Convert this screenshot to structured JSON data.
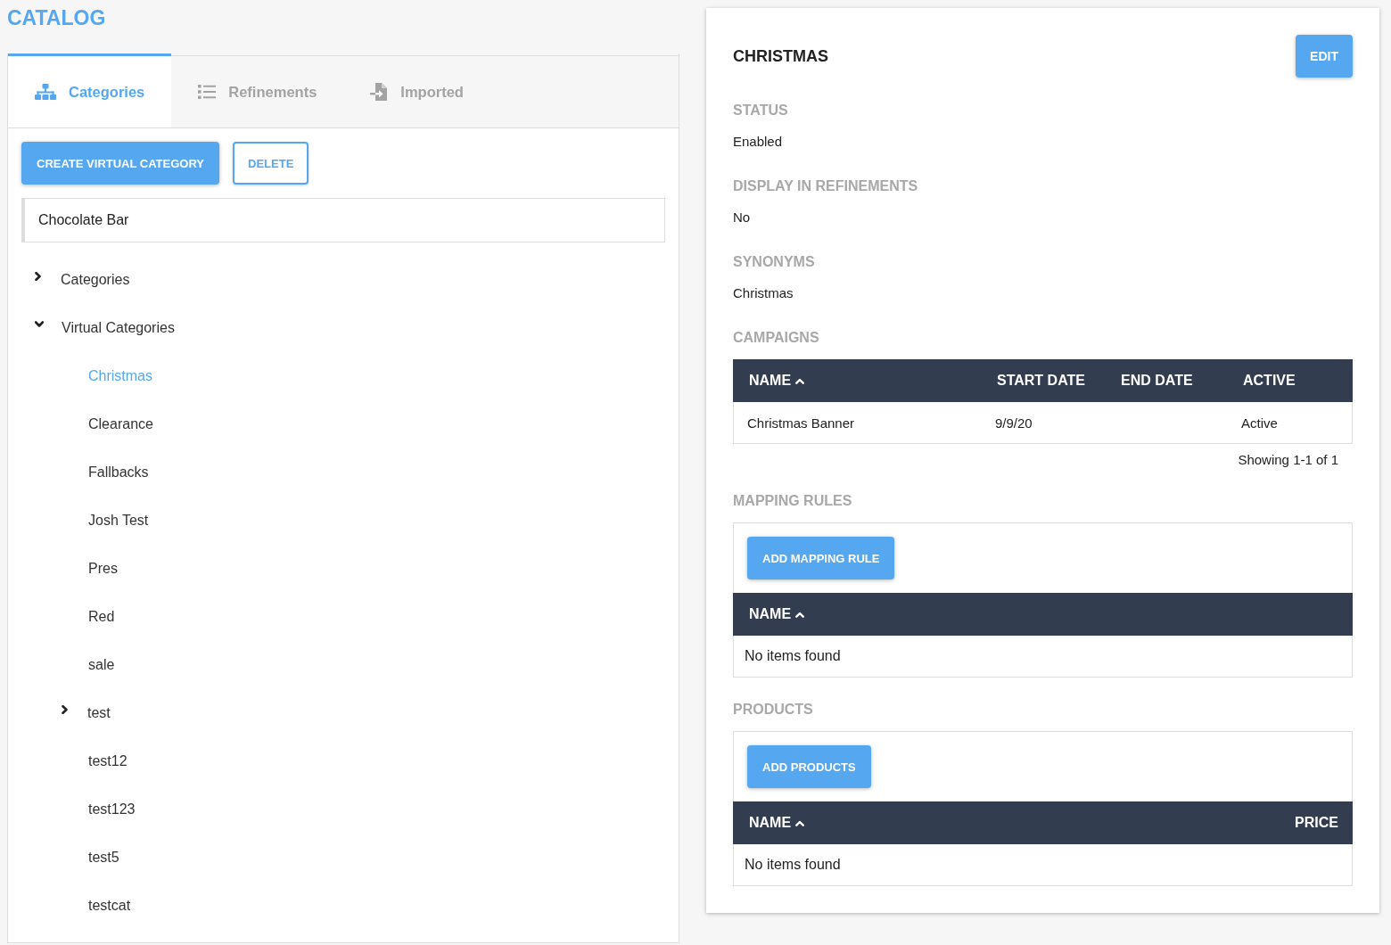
{
  "page_title": "CATALOG",
  "catalog": {
    "tabs": [
      {
        "label": "Categories",
        "selected": true
      },
      {
        "label": "Refinements",
        "selected": false
      },
      {
        "label": "Imported",
        "selected": false
      }
    ],
    "buttons": [
      {
        "label": "CREATE VIRTUAL CATEGORY",
        "kind": "primary"
      },
      {
        "label": "DELETE",
        "kind": "outline"
      }
    ],
    "filter": {
      "value": "Chocolate Bar"
    },
    "tree": [
      {
        "label": "Categories",
        "kind": "branch",
        "expanded": false,
        "selected": false
      },
      {
        "label": "Virtual Categories",
        "kind": "branch",
        "expanded": true,
        "selected": false,
        "children": [
          {
            "label": "Christmas",
            "kind": "leaf",
            "selected": true
          },
          {
            "label": "Clearance",
            "kind": "leaf",
            "selected": false
          },
          {
            "label": "Fallbacks",
            "kind": "leaf",
            "selected": false
          },
          {
            "label": "Josh Test",
            "kind": "leaf",
            "selected": false
          },
          {
            "label": "Pres",
            "kind": "leaf",
            "selected": false
          },
          {
            "label": "Red",
            "kind": "leaf",
            "selected": false
          },
          {
            "label": "sale",
            "kind": "leaf",
            "selected": false
          },
          {
            "label": "test",
            "kind": "branch",
            "expanded": false,
            "selected": false
          },
          {
            "label": "test12",
            "kind": "leaf",
            "selected": false
          },
          {
            "label": "test123",
            "kind": "leaf",
            "selected": false
          },
          {
            "label": "test5",
            "kind": "leaf",
            "selected": false
          },
          {
            "label": "testcat",
            "kind": "leaf",
            "selected": false
          }
        ]
      }
    ]
  },
  "detail": {
    "title": "CHRISTMAS",
    "edit_button": "EDIT",
    "fields": [
      {
        "label": "STATUS",
        "value": "Enabled"
      },
      {
        "label": "DISPLAY IN REFINEMENTS",
        "value": "No"
      },
      {
        "label": "SYNONYMS",
        "value": "Christmas"
      }
    ],
    "campaigns": {
      "label": "CAMPAIGNS",
      "columns": [
        {
          "label": "NAME",
          "sorted": true
        },
        {
          "label": "START DATE",
          "sorted": false
        },
        {
          "label": "END DATE",
          "sorted": false
        },
        {
          "label": "ACTIVE",
          "sorted": false
        }
      ],
      "rows": [
        {
          "cells": [
            "Christmas Banner",
            "9/9/20",
            null,
            "Active"
          ]
        }
      ],
      "footer": "Showing 1-1 of 1"
    },
    "mapping_rules": {
      "label": "MAPPING RULES",
      "button": "ADD MAPPING RULE",
      "columns": [
        {
          "label": "NAME",
          "sorted": true
        }
      ],
      "empty_text": "No items found"
    },
    "products": {
      "label": "PRODUCTS",
      "button": "ADD PRODUCTS",
      "columns": [
        {
          "label": "NAME",
          "sorted": true
        },
        {
          "label": "PRICE",
          "sorted": false
        }
      ],
      "empty_text": "No items found"
    }
  }
}
